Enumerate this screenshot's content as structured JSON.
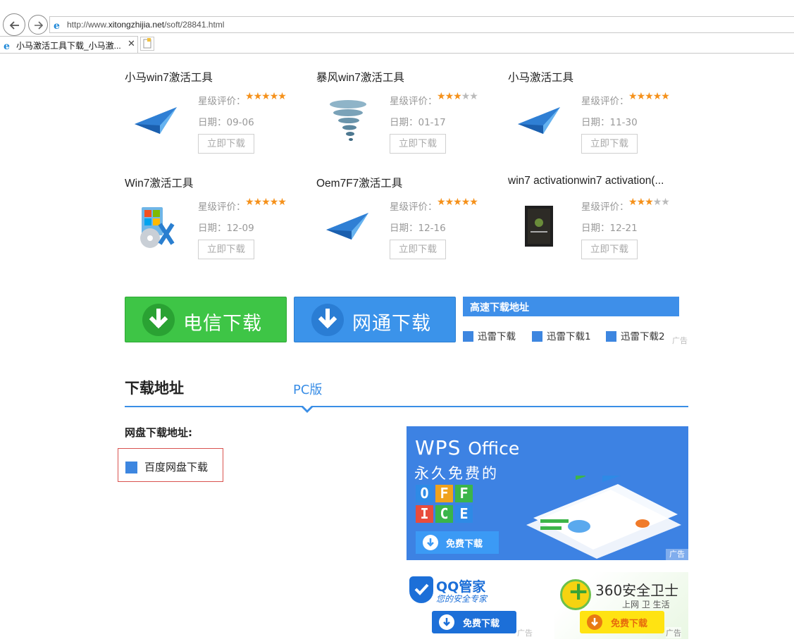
{
  "browser": {
    "url_prefix": "http://www.",
    "url_domain": "xitongzhijia.net",
    "url_path": "/soft/28841.html",
    "tab_title": "小马激活工具下载_小马激...",
    "tab_close": "✕"
  },
  "related": {
    "rating_label": "星级评价：",
    "date_label": "日期：",
    "download_label": "立即下载",
    "items": [
      {
        "title": "小马win7激活工具",
        "stars": 5,
        "date": "09-06",
        "icon": "paper-plane-icon"
      },
      {
        "title": "暴风win7激活工具",
        "stars": 3,
        "date": "01-17",
        "icon": "tornado-icon"
      },
      {
        "title": "小马激活工具",
        "stars": 5,
        "date": "11-30",
        "icon": "paper-plane-icon"
      },
      {
        "title": "Win7激活工具",
        "stars": 5,
        "date": "12-09",
        "icon": "windows-tool-icon"
      },
      {
        "title": "Oem7F7激活工具",
        "stars": 5,
        "date": "12-16",
        "icon": "paper-plane-icon"
      },
      {
        "title": "win7 activationwin7 activation(...",
        "stars": 3,
        "date": "12-21",
        "icon": "windows-box-icon"
      }
    ]
  },
  "downloads": {
    "telecom": "电信下载",
    "netcom": "网通下载",
    "fast_title": "高速下载地址",
    "fast_links": [
      "迅雷下载",
      "迅雷下载1",
      "迅雷下载2"
    ],
    "ad_label": "广告"
  },
  "section": {
    "title": "下载地址",
    "tab": "PC版",
    "netdisk_label": "网盘下载地址:",
    "baidu_link": "百度网盘下载"
  },
  "ads": {
    "wps": {
      "brand_main": "WPS",
      "brand_sub": "Office",
      "slogan": "永久免费的",
      "tiles": [
        "O",
        "F",
        "F",
        "I",
        "C",
        "E"
      ],
      "tile_colors": [
        "#2e8ae6",
        "#f0a21c",
        "#3cb54a",
        "#e84c3d",
        "#39b54a",
        "#2e8ae6"
      ],
      "button": "免费下载",
      "tag": "广告"
    },
    "qq": {
      "name": "QQ管家",
      "sub": "您的安全专家",
      "button": "免费下载",
      "tag": "广告"
    },
    "s360": {
      "name": "360安全卫士",
      "sub": "上网 卫 生活",
      "button": "免费下载",
      "tag": "广告"
    }
  }
}
